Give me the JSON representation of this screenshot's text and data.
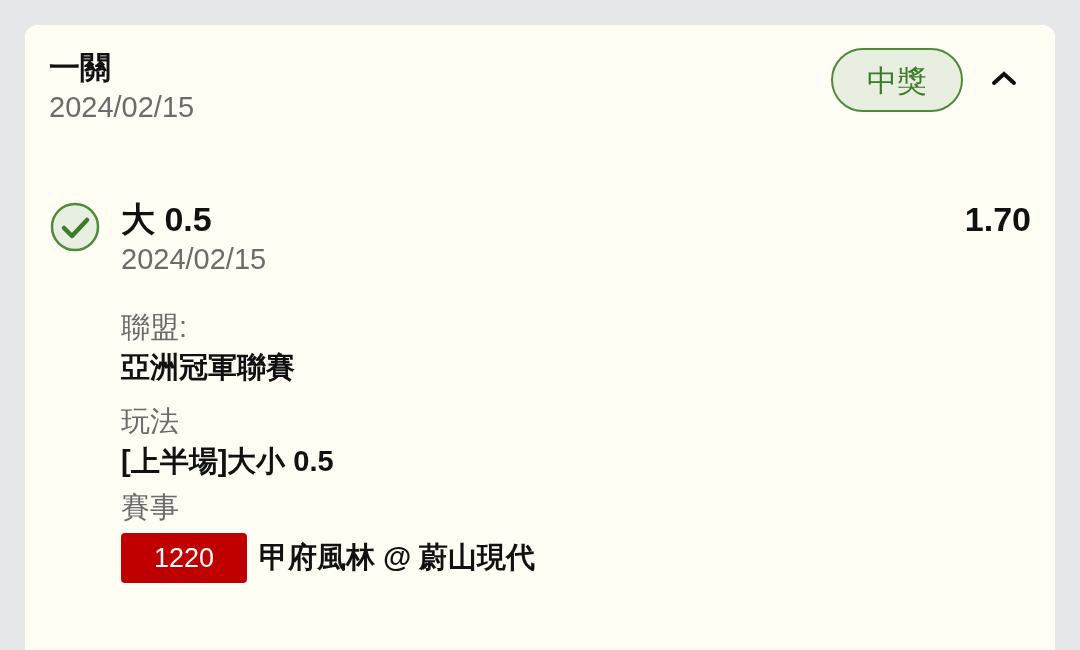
{
  "card": {
    "title": "一關",
    "date": "2024/02/15",
    "status_badge": "中獎",
    "expanded": true
  },
  "selection": {
    "checked": true,
    "pick": "大 0.5",
    "odds": "1.70",
    "date": "2024/02/15",
    "details": [
      {
        "label": "聯盟:",
        "value": "亞洲冠軍聯賽"
      },
      {
        "label": "玩法",
        "value": "[上半場]大小 0.5"
      }
    ],
    "match": {
      "label": "賽事",
      "code": "1220",
      "teams": "甲府風林 @ 蔚山現代"
    }
  }
}
